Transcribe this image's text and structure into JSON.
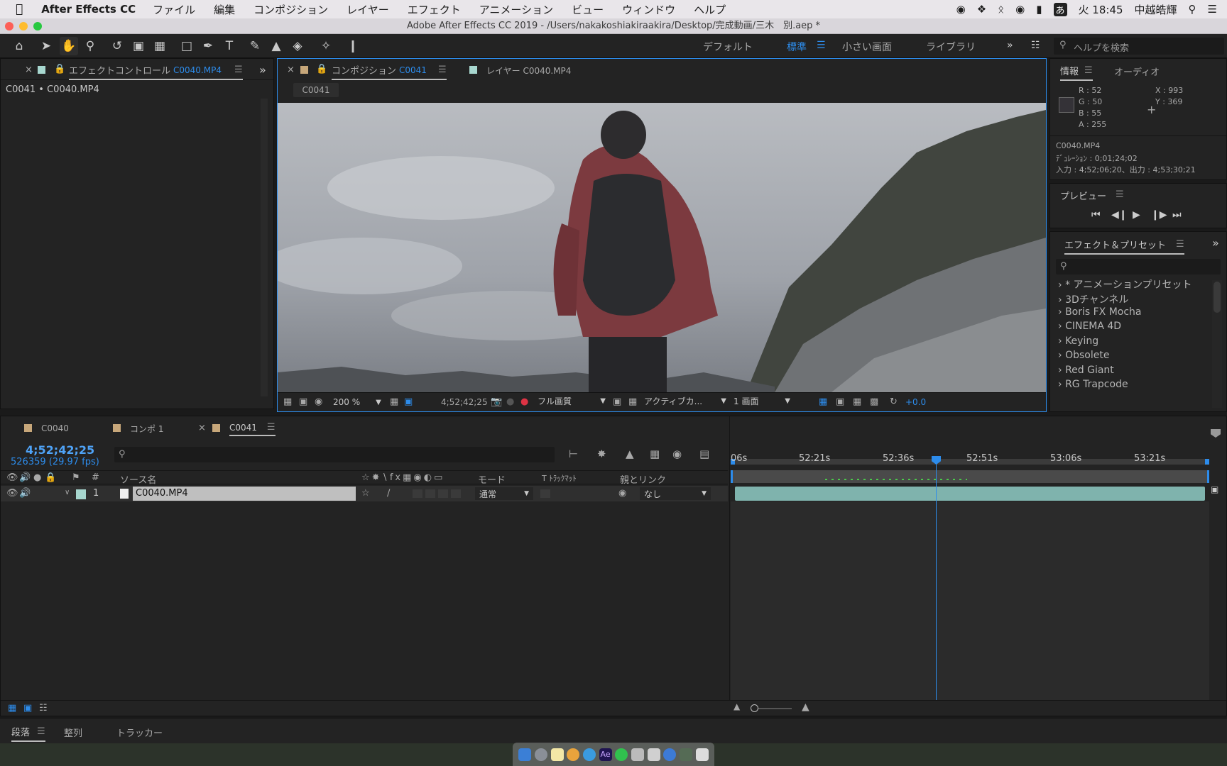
{
  "menubar": {
    "app_name": "After Effects CC",
    "items": [
      "ファイル",
      "編集",
      "コンポジション",
      "レイヤー",
      "エフェクト",
      "アニメーション",
      "ビュー",
      "ウィンドウ",
      "ヘルプ"
    ],
    "input_indicator": "あ",
    "clock": "火 18:45",
    "user": "中越皓輝"
  },
  "window_title": "Adobe After Effects CC 2019 - /Users/nakakoshiakiraakira/Desktop/完成動画/三木　別.aep *",
  "workspaces": {
    "items": [
      "デフォルト",
      "標準",
      "小さい画面",
      "ライブラリ"
    ],
    "active": "標準",
    "help_placeholder": "ヘルプを検索"
  },
  "effect_controls": {
    "tab_label": "エフェクトコントロール",
    "tab_file": "C0040.MP4",
    "breadcrumb": "C0041 • C0040.MP4"
  },
  "composition": {
    "tab_label": "コンポジション",
    "tab_comp": "C0041",
    "layer_tab": "レイヤー C0040.MP4",
    "chip": "C0041",
    "zoom": "200 %",
    "timecode": "4;52;42;25",
    "quality": "フル画質",
    "camera": "アクティブカ...",
    "views": "1 画面",
    "exposure": "+0.0"
  },
  "info": {
    "tab_info": "情報",
    "tab_audio": "オーディオ",
    "r": "R : 52",
    "g": "G : 50",
    "b": "B : 55",
    "a": "A : 255",
    "x": "X : 993",
    "y": "Y : 369",
    "file": "C0040.MP4",
    "duration": "ﾃﾞｭﾚｰｼｮﾝ : 0;01;24;02",
    "inout": "入力 : 4;52;06;20、出力 : 4;53;30;21",
    "swatch_color": "#343237"
  },
  "preview": {
    "title": "プレビュー"
  },
  "effects_presets": {
    "title": "エフェクト＆プリセット",
    "items": [
      "* アニメーションプリセット",
      "3Dチャンネル",
      "Boris FX Mocha",
      "CINEMA 4D",
      "Keying",
      "Obsolete",
      "Red Giant",
      "RG Trapcode"
    ]
  },
  "timeline": {
    "tabs": [
      "C0040",
      "コンポ 1",
      "C0041"
    ],
    "active_tab": "C0041",
    "timecode": "4;52;42;25",
    "frame_info": "526359 (29.97 fps)",
    "columns": {
      "source": "ソース名",
      "mode": "モード",
      "trkmat": "T  ﾄﾗｯｸﾏｯﾄ",
      "parent": "親とリンク"
    },
    "layer": {
      "index": "1",
      "name": "C0040.MP4",
      "mode": "通常",
      "parent": "なし"
    },
    "ruler": [
      "06s",
      "52:21s",
      "52:36s",
      "52:51s",
      "53:06s",
      "53:21s"
    ]
  },
  "bottom_tabs": [
    "段落",
    "整列",
    "トラッカー"
  ],
  "colors": {
    "accent": "#2d8ceb",
    "label_teal": "#a7d7cf",
    "label_tan": "#c7a77a",
    "clip": "#7fb3ad"
  }
}
